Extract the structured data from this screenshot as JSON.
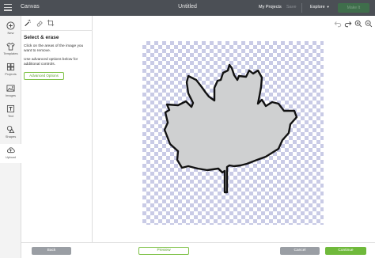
{
  "topbar": {
    "app_title": "Canvas",
    "doc_title": "Untitled",
    "my_projects": "My Projects",
    "save": "Save",
    "explore": "Explore",
    "make_it": "Make It"
  },
  "rail": {
    "items": [
      {
        "label": "New",
        "icon": "plus-circle-icon"
      },
      {
        "label": "Templates",
        "icon": "shirt-icon"
      },
      {
        "label": "Projects",
        "icon": "grid-icon"
      },
      {
        "label": "Images",
        "icon": "image-icon"
      },
      {
        "label": "Text",
        "icon": "text-icon"
      },
      {
        "label": "Shapes",
        "icon": "shapes-icon"
      },
      {
        "label": "Upload",
        "icon": "upload-cloud-icon"
      }
    ]
  },
  "panel": {
    "heading": "Select & erase",
    "desc1": "Click on the areas of the image you want to remove.",
    "desc2": "Use advanced options below for additional controls.",
    "advanced_options": "Advanced Options"
  },
  "bottombar": {
    "back": "Back",
    "preview": "Preview",
    "cancel": "Cancel",
    "continue": "Continue"
  },
  "colors": {
    "topbar": "#4b4f55",
    "accent_green": "#6fb93b",
    "checker": "#c9cbe6",
    "leaf_fill": "#cfd0d1"
  }
}
